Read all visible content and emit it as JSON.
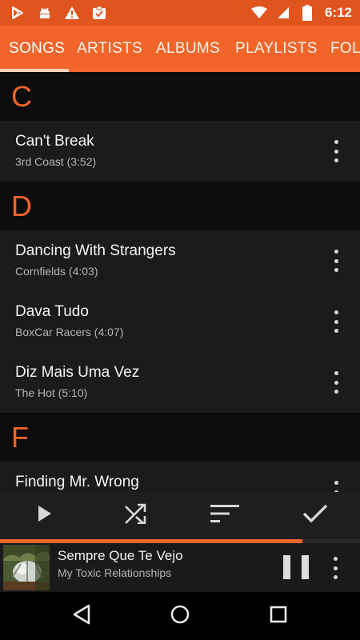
{
  "status_bar": {
    "time": "6:12",
    "notification_icons": [
      "play-store-icon",
      "android-debug-icon",
      "warning-icon",
      "checklist-icon"
    ],
    "system_icons": [
      "wifi-icon",
      "signal-icon",
      "battery-icon"
    ]
  },
  "tabs": [
    {
      "label": "SONGS",
      "active": true
    },
    {
      "label": "ARTISTS",
      "active": false
    },
    {
      "label": "ALBUMS",
      "active": false
    },
    {
      "label": "PLAYLISTS",
      "active": false
    },
    {
      "label": "FOL",
      "active": false
    }
  ],
  "sections": [
    {
      "letter": "C",
      "songs": [
        {
          "title": "Can't Break",
          "subtitle": "3rd Coast (3:52)"
        }
      ]
    },
    {
      "letter": "D",
      "songs": [
        {
          "title": "Dancing With Strangers",
          "subtitle": "Cornfields (4:03)"
        },
        {
          "title": "Dava Tudo",
          "subtitle": "BoxCar Racers (4:07)"
        },
        {
          "title": "Diz Mais Uma Vez",
          "subtitle": "The Hot (5:10)"
        }
      ]
    },
    {
      "letter": "F",
      "songs": [
        {
          "title": "Finding Mr. Wrong",
          "subtitle": ""
        }
      ]
    }
  ],
  "actions": [
    "play-icon",
    "shuffle-icon",
    "sort-icon",
    "check-icon"
  ],
  "now_playing": {
    "title": "Sempre Que Te Vejo",
    "artist": "My Toxic Relationships",
    "progress": 0.84
  },
  "colors": {
    "accent": "#f2652a",
    "status_bar": "#e0541e"
  }
}
